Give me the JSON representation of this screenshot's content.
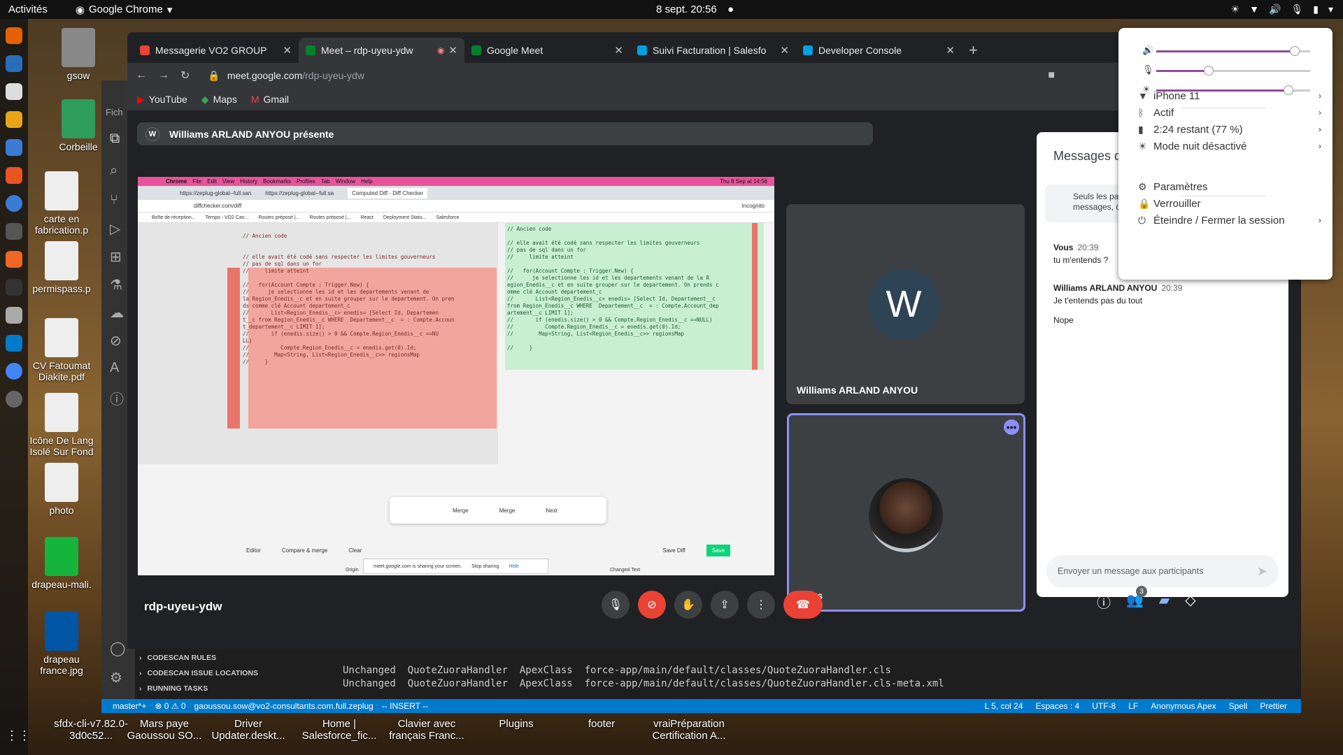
{
  "topbar": {
    "activities": "Activités",
    "app": "Google Chrome",
    "clock": "8 sept.  20:56"
  },
  "desktop": {
    "icons": [
      {
        "label": "gsow",
        "color": "#888"
      },
      {
        "label": "Corbeille",
        "color": "#2e9c5a"
      },
      {
        "label": "carte en fabrication.p",
        "color": "#eee"
      },
      {
        "label": "permispass.p",
        "color": "#eee"
      },
      {
        "label": "CV Fatoumat Diakite.pdf",
        "color": "#eee"
      },
      {
        "label": "Icône De Lang Isolé Sur Fond",
        "color": "#eee"
      },
      {
        "label": "photo",
        "color": "#eee"
      },
      {
        "label": "drapeau-mali.",
        "color": "#14b53a"
      },
      {
        "label": "drapeau france.jpg",
        "color": "#0055a4"
      },
      {
        "label": "sfdx-cli-v7.82.0-3d0c52...",
        "color": "#888"
      }
    ],
    "bottom": [
      "Mars paye Gaoussou SO...",
      "Driver Updater.deskt...",
      "Home | Salesforce_fic...",
      "Clavier avec français Franc...",
      "Plugins",
      "footer",
      "vraiPréparation Certification A..."
    ]
  },
  "chrome": {
    "tabs": [
      {
        "title": "Messagerie VO2 GROUP",
        "fav": "#ea4335"
      },
      {
        "title": "Meet – rdp-uyeu-ydw",
        "fav": "#00832d",
        "rec": "◉"
      },
      {
        "title": "Google Meet",
        "fav": "#00832d"
      },
      {
        "title": "Suivi Facturation | Salesfo",
        "fav": "#00a1e0"
      },
      {
        "title": "Developer Console",
        "fav": "#00a1e0"
      }
    ],
    "url_host": "meet.google.com",
    "url_path": "/rdp-uyeu-ydw",
    "bookmarks": [
      "YouTube",
      "Maps",
      "Gmail"
    ]
  },
  "meet": {
    "presenter_initial": "W",
    "presenter": "Williams ARLAND ANYOU présente",
    "tile1_initial": "W",
    "tile1_name": "Williams ARLAND ANYOU",
    "tile2_name": "Vous",
    "meeting_code": "rdp-uyeu-ydw",
    "people_count": "3",
    "chat": {
      "title": "Messages d",
      "note": "Seuls les pa\nmessages, q",
      "msgs": [
        {
          "from": "Vous",
          "time": "20:39",
          "text": "tu m'entends ?"
        },
        {
          "from": "Williams ARLAND ANYOU",
          "time": "20:39",
          "text": "Je t'entends pas du tout"
        },
        {
          "from": "",
          "time": "",
          "text": "Nope"
        }
      ],
      "placeholder": "Envoyer un message aux participants"
    },
    "share": {
      "menus": [
        "Chrome",
        "File",
        "Edit",
        "View",
        "History",
        "Bookmarks",
        "Profiles",
        "Tab",
        "Window",
        "Help"
      ],
      "menu_clock": "Thu 8 Sep at  14:56",
      "tabs": [
        "https://zeplug-global--full.san",
        "https://zeplug-global--full.sa",
        "Computed Diff - Diff Checker"
      ],
      "addr": "diffchecker.com/diff",
      "bookmarks": [
        "Boîte de réception...",
        "Tempo - VO2 Can...",
        "Routes préposé |...",
        "Routes préposé |...",
        "React",
        "Deployment Statu...",
        "Salesforce"
      ],
      "incognito": "Incognito",
      "left_code": "// Ancien code\n\n\n// elle avait été codé sans respecter les limites gouverneurs\n// pas de sql dans un for\n//     limite atteint\n\n//   for(Account Compte : Trigger.New) {\n//      je selectionne les id et les departements venant de\nla Region_Enedis__c et en suite grouper sur le departement. On pren\nds comme clé Account departement_c\n//       List<Region_Enedis__c> enedis= [Select Id, Departemen\nt__c from Region_Enedis__c WHERE  Departement__c  = : Compte.Accoun\nt_departement__c LIMIT 1];\n//       if (enedis.size() > 0 && Compte.Region_Enedis__c ==NU\nLL)\n//          Compte.Region_Enedis__c = enedis.get(0).Id;\n//        Map<String, List<Region_Enedis__c>> regionsMap\n//     }",
      "right_code": "// Ancien code\n\n// elle avait été codé sans respecter les limites gouverneurs\n// pas de sql dans un for\n//     limite atteint\n\n//   for(Account Compte : Trigger.New) {\n//      je selectionne les id et les departements venant de la R\negion_Enedis__c et en suite grouper sur le departement. On prends c\nomme clé Account departement_c\n//       List<Region_Enedis__c> enedis= [Select Id, Departement__c\nfrom Region_Enedis__c WHERE  Departement__c  = : Compte.Account_dep\nartement__c LIMIT 1];\n//       if (enedis.size() > 0 && Compte.Region_Enedis__c ==NULL)\n//          Compte.Region_Enedis__c = enedis.get(0).Id;\n//        Map<String, List<Region_Enedis__c>> regionsMap\n\n//     }",
      "merge_left": "Merge",
      "merge_right": "Merge",
      "next": "Next",
      "bottom": [
        "Editor",
        "Compare & merge",
        "Clear",
        "Save Diff",
        "Save"
      ],
      "sharing": "meet.google.com is sharing your screen.",
      "stop": "Stop sharing",
      "hide": "Hide",
      "orig": "Origin",
      "changed": "Changed Text"
    }
  },
  "vscode": {
    "side": [
      "CODESCAN RULES",
      "CODESCAN ISSUE LOCATIONS",
      "RUNNING TASKS"
    ],
    "terminal": [
      "Unchanged  QuoteZuoraHandler  ApexClass  force-app/main/default/classes/QuoteZuoraHandler.cls",
      "Unchanged  QuoteZuoraHandler  ApexClass  force-app/main/default/classes/QuoteZuoraHandler.cls-meta.xml"
    ],
    "status_left": [
      "master*+",
      "⊗ 0 ⚠ 0",
      "gaoussou.sow@vo2-consultants.com.full.zeplug",
      "-- INSERT --"
    ],
    "status_right": [
      "L 5, col 24",
      "Espaces : 4",
      "UTF-8",
      "LF",
      "Anonymous Apex",
      "Spell",
      "Prettier"
    ]
  },
  "quick": {
    "volume": 0.9,
    "mic": 0.34,
    "brightness": 0.86,
    "items": [
      {
        "icon": "wifi-icon",
        "label": "iPhone 11",
        "arrow": true
      },
      {
        "icon": "bluetooth-icon",
        "label": "Actif",
        "arrow": true
      },
      {
        "icon": "battery-icon",
        "label": "2:24 restant (77 %)",
        "arrow": true
      },
      {
        "icon": "night-icon",
        "label": "Mode nuit désactivé",
        "arrow": true
      },
      {
        "icon": "settings-icon",
        "label": "Paramètres",
        "arrow": false
      },
      {
        "icon": "lock-icon",
        "label": "Verrouiller",
        "arrow": false
      },
      {
        "icon": "power-icon",
        "label": "Éteindre / Fermer la session",
        "arrow": true
      }
    ]
  }
}
